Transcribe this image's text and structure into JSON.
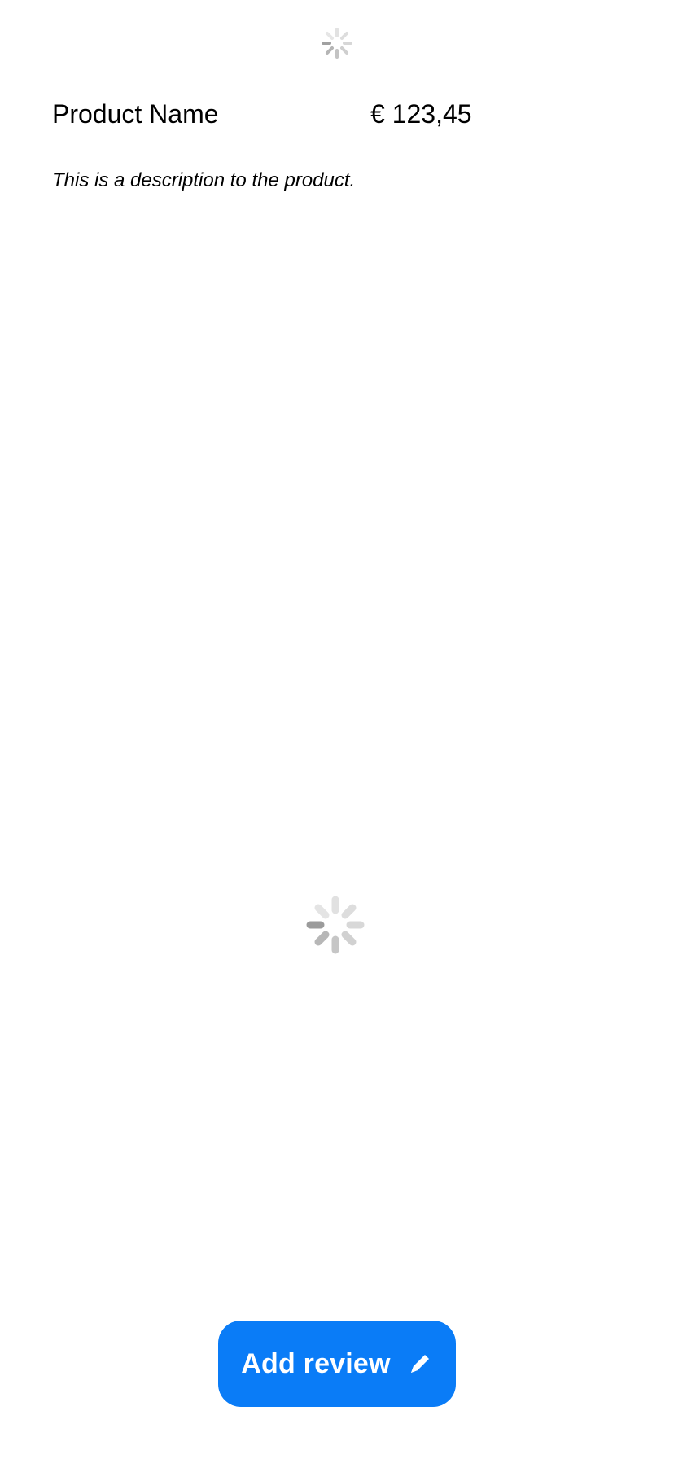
{
  "spinners": {
    "top": "loading-spinner-icon",
    "main": "loading-spinner-icon"
  },
  "product": {
    "name": "Product Name",
    "price": "€ 123,45",
    "description": "This is a description to the product."
  },
  "actions": {
    "add_review_label": "Add review",
    "add_review_icon": "pencil-icon"
  },
  "colors": {
    "accent": "#0a7cf7",
    "spinner_light": "#d7d7d7",
    "spinner_dark": "#9b9b9b",
    "text": "#000000"
  }
}
